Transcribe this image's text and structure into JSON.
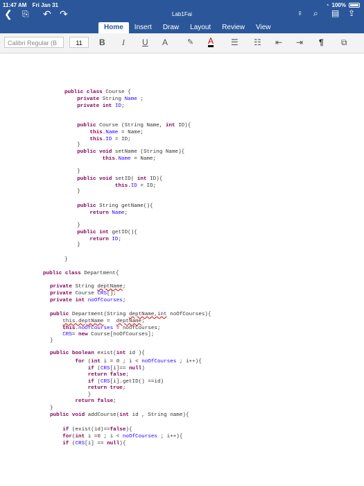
{
  "status_bar": {
    "time": "11:47 AM",
    "date": "Fri Jan 31",
    "battery": "100%"
  },
  "app": {
    "title": "Lab1Fai"
  },
  "tabs": [
    "Home",
    "Insert",
    "Draw",
    "Layout",
    "Review",
    "View"
  ],
  "ribbon": {
    "font_name": "Calibri Regular (B",
    "font_size": "11",
    "bold": "B",
    "italic": "I",
    "underline": "U",
    "font_size_change": "A",
    "font_color": "A",
    "paragraph_marks": "¶"
  },
  "document": {
    "lines": [
      [
        {
          "k": "kw",
          "t": "public class"
        },
        {
          "t": " Course {"
        }
      ],
      [
        {
          "t": "    "
        },
        {
          "k": "kw",
          "t": "private"
        },
        {
          "t": " String "
        },
        {
          "k": "id",
          "t": "Name"
        },
        {
          "t": " ;"
        }
      ],
      [
        {
          "t": "    "
        },
        {
          "k": "kw",
          "t": "private int"
        },
        {
          "t": " "
        },
        {
          "k": "id",
          "t": "ID"
        },
        {
          "t": ";"
        }
      ],
      [
        {
          "t": "    "
        },
        {
          "k": "kw",
          "t": "public"
        },
        {
          "t": " Course (String Name, "
        },
        {
          "k": "kw",
          "t": "int"
        },
        {
          "t": " ID){"
        }
      ],
      [
        {
          "t": "        "
        },
        {
          "k": "kw",
          "t": "this"
        },
        {
          "t": "."
        },
        {
          "k": "id",
          "t": "Name"
        },
        {
          "t": " = Name;"
        }
      ],
      [
        {
          "t": "        "
        },
        {
          "k": "kw",
          "t": "this"
        },
        {
          "t": "."
        },
        {
          "k": "id",
          "t": "ID"
        },
        {
          "t": " = ID;"
        }
      ],
      [
        {
          "t": "    }"
        }
      ],
      [
        {
          "t": "    "
        },
        {
          "k": "kw",
          "t": "public void"
        },
        {
          "t": " setName (String Name){"
        }
      ],
      [
        {
          "t": "            "
        },
        {
          "k": "kw",
          "t": "this"
        },
        {
          "t": "."
        },
        {
          "k": "id",
          "t": "Name"
        },
        {
          "t": " = Name;"
        }
      ],
      [
        {
          "t": "    }"
        }
      ],
      [
        {
          "t": "    "
        },
        {
          "k": "kw",
          "t": "public void"
        },
        {
          "t": " setID( "
        },
        {
          "k": "kw",
          "t": "int"
        },
        {
          "t": " ID){"
        }
      ],
      [
        {
          "t": "                "
        },
        {
          "k": "kw",
          "t": "this"
        },
        {
          "t": "."
        },
        {
          "k": "id",
          "t": "ID"
        },
        {
          "t": " = ID;"
        }
      ],
      [
        {
          "t": "    }"
        }
      ],
      [
        {
          "t": "    "
        },
        {
          "k": "kw",
          "t": "public"
        },
        {
          "t": " String getName(){"
        }
      ],
      [
        {
          "t": "        "
        },
        {
          "k": "kw",
          "t": "return"
        },
        {
          "t": " "
        },
        {
          "k": "id",
          "t": "Name"
        },
        {
          "t": ";"
        }
      ],
      [
        {
          "t": "    }"
        }
      ],
      [
        {
          "t": "    "
        },
        {
          "k": "kw",
          "t": "public int"
        },
        {
          "t": " getID(){"
        }
      ],
      [
        {
          "t": "        "
        },
        {
          "k": "kw",
          "t": "return"
        },
        {
          "t": " "
        },
        {
          "k": "id",
          "t": "ID"
        },
        {
          "t": ";"
        }
      ],
      [
        {
          "t": "    }"
        }
      ],
      [
        {
          "t": "}"
        }
      ],
      [
        {
          "k": "kw",
          "t": "public class"
        },
        {
          "t": " Department{"
        }
      ],
      [
        {
          "k": "kw",
          "t": "private"
        },
        {
          "t": " String "
        },
        {
          "k": "sq",
          "t": "deptName"
        },
        {
          "t": ";"
        }
      ],
      [
        {
          "k": "kw",
          "t": "private"
        },
        {
          "t": " Course "
        },
        {
          "k": "id",
          "t": "CRS"
        },
        {
          "t": "[];"
        }
      ],
      [
        {
          "k": "kw",
          "t": "private int"
        },
        {
          "t": " "
        },
        {
          "k": "id",
          "t": "noOfCourses"
        },
        {
          "t": ";"
        }
      ],
      [
        {
          "k": "kw",
          "t": "public"
        },
        {
          "t": " Department(String "
        },
        {
          "k": "sq",
          "t": "deptName,int"
        },
        {
          "t": " noOfCourses){"
        }
      ],
      [
        {
          "t": "    "
        },
        {
          "k": "sq",
          "t": "this.deptName"
        },
        {
          "t": " =  "
        },
        {
          "k": "sq",
          "t": "deptName"
        },
        {
          "t": ";"
        }
      ],
      [
        {
          "t": "    "
        },
        {
          "k": "kw",
          "t": "this"
        },
        {
          "t": "."
        },
        {
          "k": "id",
          "t": "noOfCourses"
        },
        {
          "t": " = noOfCourses;"
        }
      ],
      [
        {
          "t": "    "
        },
        {
          "k": "id",
          "t": "CRS"
        },
        {
          "t": "= "
        },
        {
          "k": "kw",
          "t": "new"
        },
        {
          "t": " Course[noOfCourses];"
        }
      ],
      [
        {
          "t": "}"
        }
      ],
      [
        {
          "k": "kw",
          "t": "public boolean"
        },
        {
          "t": " exist("
        },
        {
          "k": "kw",
          "t": "int"
        },
        {
          "t": " id ){"
        }
      ],
      [
        {
          "t": "        "
        },
        {
          "k": "kw",
          "t": "for"
        },
        {
          "t": " ("
        },
        {
          "k": "kw",
          "t": "int"
        },
        {
          "t": " i = 0 ; i < "
        },
        {
          "k": "id",
          "t": "noOfCourses"
        },
        {
          "t": " ; i++){"
        }
      ],
      [
        {
          "t": "            "
        },
        {
          "k": "kw",
          "t": "if"
        },
        {
          "t": " ("
        },
        {
          "k": "id",
          "t": "CRS"
        },
        {
          "t": "[i]== "
        },
        {
          "k": "kw",
          "t": "null"
        },
        {
          "t": ")"
        }
      ],
      [
        {
          "t": "            "
        },
        {
          "k": "kw",
          "t": "return false"
        },
        {
          "t": ";"
        }
      ],
      [
        {
          "t": "            "
        },
        {
          "k": "kw",
          "t": "if"
        },
        {
          "t": " ("
        },
        {
          "k": "id",
          "t": "CRS"
        },
        {
          "t": "[i].getID() ==id)"
        }
      ],
      [
        {
          "t": "            "
        },
        {
          "k": "kw",
          "t": "return true"
        },
        {
          "t": ";"
        }
      ],
      [
        {
          "t": "            }"
        }
      ],
      [
        {
          "t": "        "
        },
        {
          "k": "kw",
          "t": "return false"
        },
        {
          "t": ";"
        }
      ],
      [
        {
          "t": "}"
        }
      ],
      [
        {
          "k": "kw",
          "t": "public void"
        },
        {
          "t": " addCourse("
        },
        {
          "k": "kw",
          "t": "int"
        },
        {
          "t": " id , String name){"
        }
      ],
      [
        {
          "t": "    "
        },
        {
          "k": "kw",
          "t": "if"
        },
        {
          "t": " (exist(id)=="
        },
        {
          "k": "kw",
          "t": "false"
        },
        {
          "t": "){"
        }
      ],
      [
        {
          "t": "    "
        },
        {
          "k": "kw",
          "t": "for"
        },
        {
          "t": "("
        },
        {
          "k": "kw",
          "t": "int"
        },
        {
          "t": " i =0 ; i < "
        },
        {
          "k": "id",
          "t": "noOfCourses"
        },
        {
          "t": " ; i++){"
        }
      ],
      [
        {
          "t": "    "
        },
        {
          "k": "kw",
          "t": "if"
        },
        {
          "t": " ("
        },
        {
          "k": "id",
          "t": "CRS"
        },
        {
          "t": "[i] == "
        },
        {
          "k": "kw",
          "t": "null"
        },
        {
          "t": "){"
        }
      ]
    ]
  }
}
